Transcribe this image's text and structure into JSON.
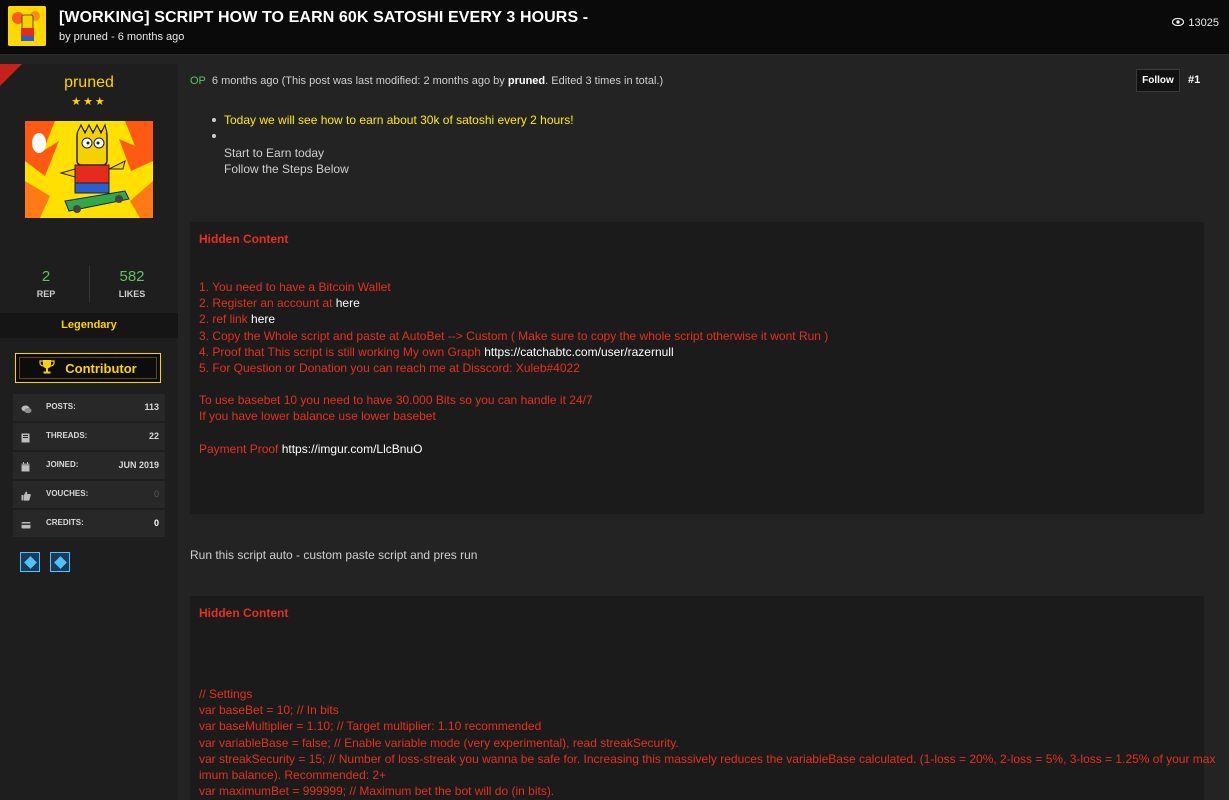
{
  "thread": {
    "title": "[WORKING] SCRIPT HOW TO EARN 60K SATOSHI EVERY 3 HOURS -",
    "meta": "by pruned - 6 months ago",
    "views": "13025"
  },
  "author": {
    "username": "pruned",
    "stars": "★★★",
    "rep_value": "2",
    "rep_label": "REP",
    "likes_value": "582",
    "likes_label": "LIKES",
    "rank": "Legendary",
    "badge_label": "Contributor",
    "stats": [
      {
        "label": "POSTS:",
        "value": "113",
        "icon": "comments-icon"
      },
      {
        "label": "THREADS:",
        "value": "22",
        "icon": "book-icon"
      },
      {
        "label": "JOINED:",
        "value": "JUN 2019",
        "icon": "calendar-icon"
      },
      {
        "label": "VOUCHES:",
        "value": "0",
        "icon": "thumbs-up-icon"
      },
      {
        "label": "CREDITS:",
        "value": "0",
        "icon": "credit-icon"
      }
    ]
  },
  "post": {
    "op_tag": "OP",
    "header_prefix": "6 months ago (This post was last modified: 2 months ago by ",
    "header_user": "pruned",
    "header_suffix": ". Edited 3 times in total.)",
    "follow_label": "Follow",
    "post_number": "#1",
    "bullet1": "Today we will see how to earn about 30k of satoshi every 2 hours!",
    "intro_line1": "Start to Earn today",
    "intro_line2": "Follow the Steps Below",
    "hidden1": {
      "title": "Hidden Content",
      "step1": "1. You need to have a Bitcoin Wallet",
      "step2_text": "2. Register an account at ",
      "step2_link": "here",
      "step3_text": "2. ref link ",
      "step3_link": "here",
      "step4": "3. Copy the Whole script and paste at AutoBet --> Custom  ( Make sure to copy the whole script otherwise it wont Run )",
      "step5_text": "4. Proof that This script is still working My own Graph ",
      "step5_link": "https://catchabtc.com/user/razernull",
      "step6": "5. For Question or Donation you can reach me at Disscord:  Xuleb#4022",
      "note1": "To use basebet 10 you need to have 30.000 Bits so you can handle it 24/7",
      "note2": "If you have lower balance use lower basebet",
      "proof_text": "Payment Proof ",
      "proof_link": "https://imgur.com/LlcBnuO"
    },
    "middle_text": "Run this script auto - custom  paste script and pres run",
    "hidden2": {
      "title": "Hidden Content",
      "code1": "// Settings",
      "code2": "var baseBet = 10; // In bits",
      "code3": "var baseMultiplier = 1.10; // Target multiplier: 1.10 recommended",
      "code4": "var variableBase = false; // Enable variable mode (very experimental), read streakSecurity.",
      "code5": "var streakSecurity = 15; // Number of loss-streak you wanna be safe for. Increasing this massively reduces the variableBase calculated. (1-loss = 20%, 2-loss = 5%, 3-loss = 1.25% of your max",
      "code6": "imum balance). Recommended: 2+",
      "code7": "var maximumBet = 999999; // Maximum bet the bot will do (in bits)."
    }
  },
  "colors": {
    "accent_yellow": "#ffd200",
    "hidden_red": "#e5301f",
    "green": "#5fc25f",
    "award_blue": "#4fc3ff"
  }
}
